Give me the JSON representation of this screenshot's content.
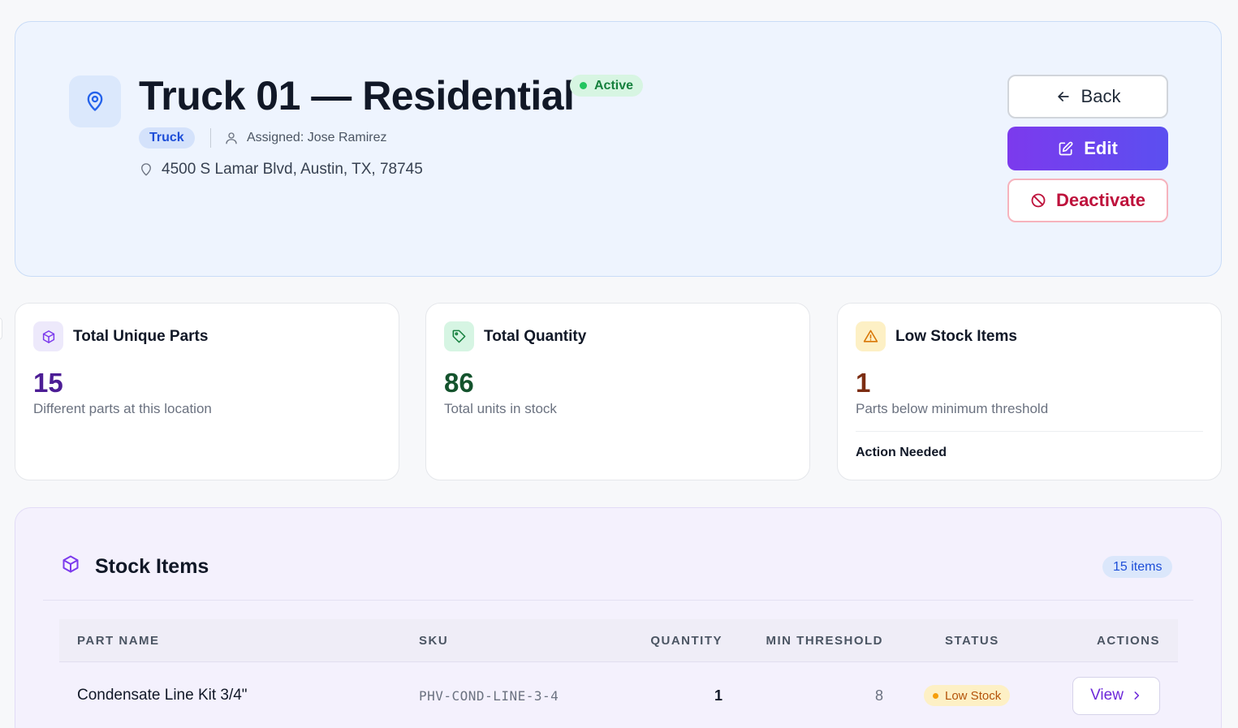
{
  "header": {
    "title": "Truck 01 — Residential",
    "status": "Active",
    "type": "Truck",
    "assigned": "Assigned: Jose Ramirez",
    "address": "4500 S Lamar Blvd, Austin, TX, 78745"
  },
  "actions": {
    "back": "Back",
    "edit": "Edit",
    "deactivate": "Deactivate"
  },
  "stats": [
    {
      "title": "Total Unique Parts",
      "value": "15",
      "desc": "Different parts at this location",
      "icon": "cube-icon"
    },
    {
      "title": "Total Quantity",
      "value": "86",
      "desc": "Total units in stock",
      "icon": "tag-icon"
    },
    {
      "title": "Low Stock Items",
      "value": "1",
      "desc": "Parts below minimum threshold",
      "note": "Action Needed",
      "icon": "warning-icon"
    }
  ],
  "stock": {
    "title": "Stock Items",
    "count_label": "15 items",
    "columns": [
      "PART NAME",
      "SKU",
      "QUANTITY",
      "MIN THRESHOLD",
      "STATUS",
      "ACTIONS"
    ],
    "rows": [
      {
        "name": "Condensate Line Kit 3/4\"",
        "sku": "PHV-COND-LINE-3-4",
        "quantity": "1",
        "min": "8",
        "status": "Low Stock",
        "action": "View"
      }
    ]
  },
  "colors": {
    "accent": "#7c3aed",
    "active": "#22c55e",
    "danger": "#be123c",
    "warning": "#f59e0b"
  }
}
